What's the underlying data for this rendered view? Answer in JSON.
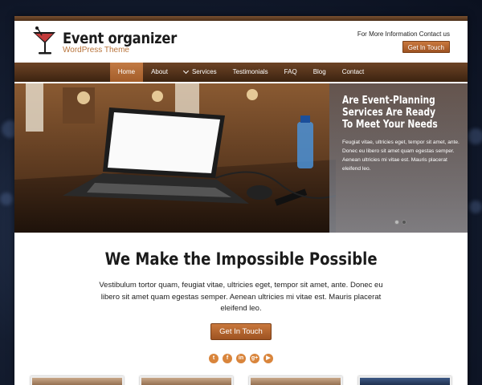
{
  "header": {
    "logo_title": "Event organizer",
    "logo_subtitle": "WordPress Theme",
    "contact_label": "For More Information Contact us",
    "contact_button": "Get In Touch",
    "logo_icon": "cocktail-glass-icon"
  },
  "nav": {
    "items": [
      {
        "label": "Home",
        "active": true
      },
      {
        "label": "About"
      },
      {
        "label": "Services",
        "has_dropdown": true
      },
      {
        "label": "Testimonials"
      },
      {
        "label": "FAQ"
      },
      {
        "label": "Blog"
      },
      {
        "label": "Contact"
      }
    ]
  },
  "slider": {
    "title": "Are Event-Planning Services Are Ready To Meet Your Needs",
    "text": "Feugiat vitae, ultricies eget, tempor sit amet, ante. Donec eu libero sit amet quam egestas semper. Aenean ultricies mi vitae est. Mauris placerat eleifend leo.",
    "slide_count": 2,
    "active_slide": 2
  },
  "hero": {
    "title": "We Make the Impossible Possible",
    "text": "Vestibulum tortor quam, feugiat vitae, ultricies eget, tempor sit amet, ante. Donec eu libero sit amet quam egestas semper. Aenean ultricies mi vitae est. Mauris placerat eleifend leo.",
    "button": "Get In Touch"
  },
  "social": [
    {
      "icon": "twitter-icon",
      "glyph": "t"
    },
    {
      "icon": "facebook-icon",
      "glyph": "f"
    },
    {
      "icon": "linkedin-icon",
      "glyph": "in"
    },
    {
      "icon": "google-plus-icon",
      "glyph": "g+"
    },
    {
      "icon": "youtube-icon",
      "glyph": "▶"
    }
  ],
  "colors": {
    "accent": "#b8733a",
    "nav_bg": "#4a2c15",
    "button": "#a85b28"
  }
}
